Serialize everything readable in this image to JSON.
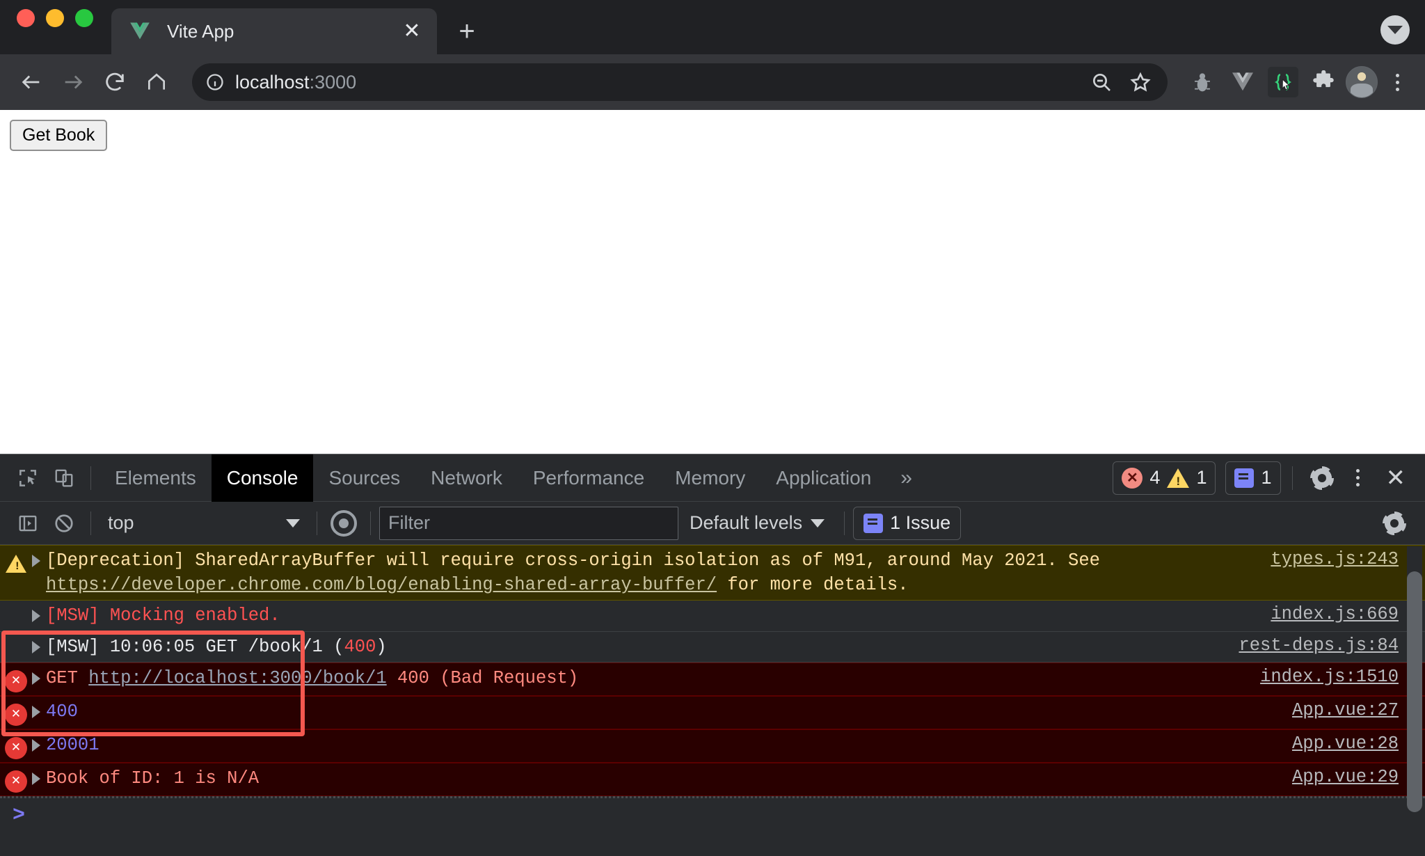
{
  "browser": {
    "tab": {
      "title": "Vite App",
      "favicon": "vue-logo-icon",
      "close_label": "✕"
    },
    "new_tab_label": "+",
    "tab_search": "tab-search-icon",
    "nav": {
      "back": "←",
      "forward": "→",
      "reload": "↻",
      "home": "⌂"
    },
    "omnibox": {
      "info_icon": "site-info-icon",
      "url_host": "localhost",
      "url_port": ":3000",
      "zoom_icon": "zoom-out-icon",
      "bookmark_icon": "star-icon"
    },
    "extensions": [
      "bug-extension-icon",
      "vue-devtools-icon",
      "braces-cursor-extension-icon",
      "puzzle-extensions-icon"
    ],
    "profile": "avatar",
    "menu": "chrome-menu-icon"
  },
  "page": {
    "get_book_button": "Get Book"
  },
  "devtools": {
    "tools": {
      "inspect": "inspect-element-icon",
      "device": "device-toolbar-icon"
    },
    "tabs": [
      {
        "label": "Elements",
        "active": false
      },
      {
        "label": "Console",
        "active": true
      },
      {
        "label": "Sources",
        "active": false
      },
      {
        "label": "Network",
        "active": false
      },
      {
        "label": "Performance",
        "active": false
      },
      {
        "label": "Memory",
        "active": false
      },
      {
        "label": "Application",
        "active": false
      }
    ],
    "more_tabs": "»",
    "counters": {
      "errors": "4",
      "warnings": "1",
      "issues": "1"
    },
    "settings_icon": "gear-icon",
    "kebab_icon": "more-options-icon",
    "close_icon": "✕",
    "filterbar": {
      "sidebar_toggle": "console-sidebar-icon",
      "clear_console": "clear-console-icon",
      "context": "top",
      "eye_icon": "live-expression-icon",
      "filter_placeholder": "Filter",
      "filter_value": "",
      "levels": "Default levels",
      "issues_pill": "1 Issue",
      "settings_icon": "gear-icon"
    },
    "messages": [
      {
        "kind": "warning",
        "icon": "warning-triangle-icon",
        "expand": true,
        "segments": [
          {
            "text": "[Deprecation] SharedArrayBuffer will require cross-origin isolation as of M91, around May 2021. See ",
            "style": "warn"
          },
          {
            "text": "https://developer.chrome.com/blog/enabling-shared-array-buffer/",
            "style": "link-warn"
          },
          {
            "text": " for more details.",
            "style": "warn"
          }
        ],
        "source": "types.js:243"
      },
      {
        "kind": "plain",
        "icon": "none",
        "expand": true,
        "segments": [
          {
            "text": "[MSW] Mocking enabled.",
            "style": "red"
          }
        ],
        "source": "index.js:669"
      },
      {
        "kind": "plain",
        "icon": "none",
        "expand": true,
        "segments": [
          {
            "text": "[MSW] 10:06:05 GET /book/1 (",
            "style": "white"
          },
          {
            "text": "400",
            "style": "red"
          },
          {
            "text": ")",
            "style": "white"
          }
        ],
        "source": "rest-deps.js:84"
      },
      {
        "kind": "error",
        "icon": "error-circle-icon",
        "expand": true,
        "segments": [
          {
            "text": "GET ",
            "style": "salmon"
          },
          {
            "text": "http://localhost:3000/book/1",
            "style": "link"
          },
          {
            "text": " 400 (Bad Request)",
            "style": "salmon"
          }
        ],
        "source": "index.js:1510"
      },
      {
        "kind": "error",
        "icon": "error-circle-icon",
        "expand": true,
        "segments": [
          {
            "text": "400",
            "style": "blue"
          }
        ],
        "source": "App.vue:27"
      },
      {
        "kind": "error",
        "icon": "error-circle-icon",
        "expand": true,
        "segments": [
          {
            "text": "20001",
            "style": "blue"
          }
        ],
        "source": "App.vue:28"
      },
      {
        "kind": "error",
        "icon": "error-circle-icon",
        "expand": true,
        "segments": [
          {
            "text": "Book of ID: 1 is N/A",
            "style": "salmon"
          }
        ],
        "source": "App.vue:29"
      }
    ],
    "prompt": ">"
  },
  "annotation": {
    "color": "#f4584f"
  }
}
